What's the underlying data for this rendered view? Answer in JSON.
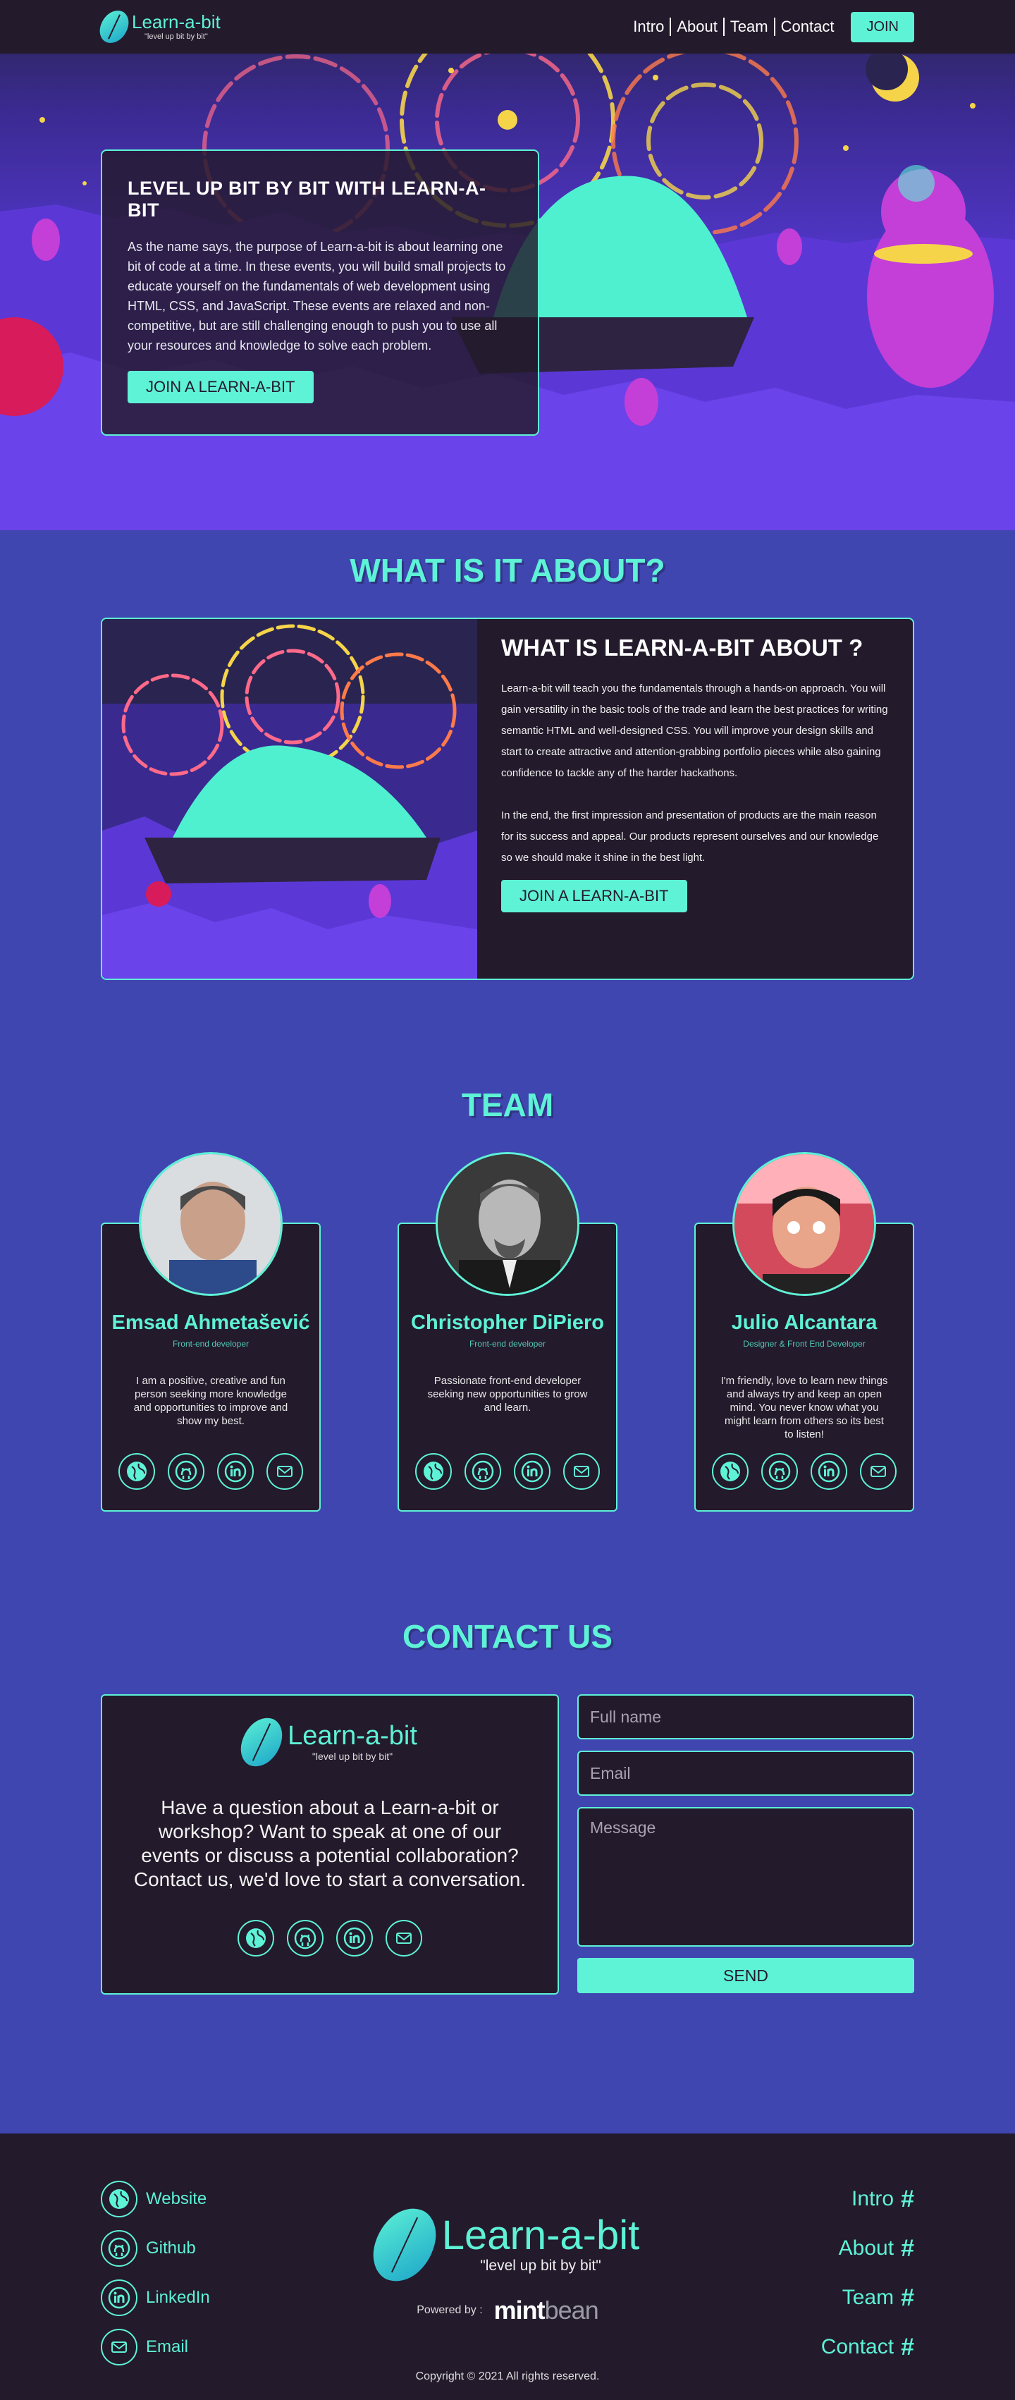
{
  "nav": {
    "brand_name": "Learn-a-bit",
    "brand_tagline": "\"level up bit by bit\"",
    "links": [
      "Intro",
      "About",
      "Team",
      "Contact"
    ],
    "join_label": "JOIN"
  },
  "hero": {
    "title": "LEVEL UP BIT BY BIT WITH LEARN-A-BIT",
    "text": "As the name says, the purpose of Learn-a-bit is about learning one bit of code at a time. In these events, you will build small projects to educate yourself on the fundamentals of web development using HTML, CSS, and JavaScript. These events are relaxed and non-competitive, but are still challenging enough to push you to use all your resources and knowledge to solve each problem.",
    "cta": "JOIN A LEARN-A-BIT"
  },
  "about": {
    "section_title": "WHAT IS IT ABOUT?",
    "title": "WHAT IS LEARN-A-BIT ABOUT ?",
    "p1": "Learn-a-bit will teach you the fundamentals through a hands-on approach. You will gain versatility in the basic tools of the trade and learn the best practices for writing semantic HTML and well-designed CSS. You will improve your design skills and start to create attractive and attention-grabbing portfolio pieces while also gaining confidence to tackle any of the harder hackathons.",
    "p2": "In the end, the first impression and presentation of products are the main reason for its success and appeal. Our products represent ourselves and our knowledge so we should make it shine in the best light.",
    "cta": "JOIN A LEARN-A-BIT"
  },
  "team": {
    "section_title": "TEAM",
    "members": [
      {
        "name": "Emsad Ahmetašević",
        "role": "Front-end developer",
        "bio": "I am a positive, creative and fun person seeking more knowledge and opportunities to improve and show my best."
      },
      {
        "name": "Christopher DiPiero",
        "role": "Front-end developer",
        "bio": "Passionate front-end developer seeking new opportunities to grow and learn."
      },
      {
        "name": "Julio Alcantara",
        "role": "Designer & Front End Developer",
        "bio": "I'm friendly, love to learn new things and always try and keep an open mind. You never know what you might learn from others so its best to listen!"
      }
    ]
  },
  "contact": {
    "section_title": "CONTACT US",
    "brand_name": "Learn-a-bit",
    "brand_tagline": "\"level up bit by bit\"",
    "text": "Have a question about a Learn-a-bit or workshop? Want to speak at one of our events or discuss a potential collaboration? Contact us, we'd love to start a conversation.",
    "name_placeholder": "Full name",
    "email_placeholder": "Email",
    "message_placeholder": "Message",
    "send_label": "SEND"
  },
  "footer": {
    "links": [
      "Website",
      "Github",
      "LinkedIn",
      "Email"
    ],
    "brand_name": "Learn-a-bit",
    "brand_tagline": "\"level up bit by bit\"",
    "powered_by": "Powered by :",
    "mint_a": "mint",
    "mint_b": "bean",
    "nav": [
      "Intro",
      "About",
      "Team",
      "Contact"
    ],
    "hash": "#",
    "copyright": "Copyright © 2021 All rights reserved."
  },
  "colors": {
    "teal": "#5ef2d6",
    "dark": "#231a2b",
    "purple": "#4046b0"
  },
  "icons": [
    "globe-icon",
    "github-icon",
    "linkedin-icon",
    "mail-icon"
  ]
}
